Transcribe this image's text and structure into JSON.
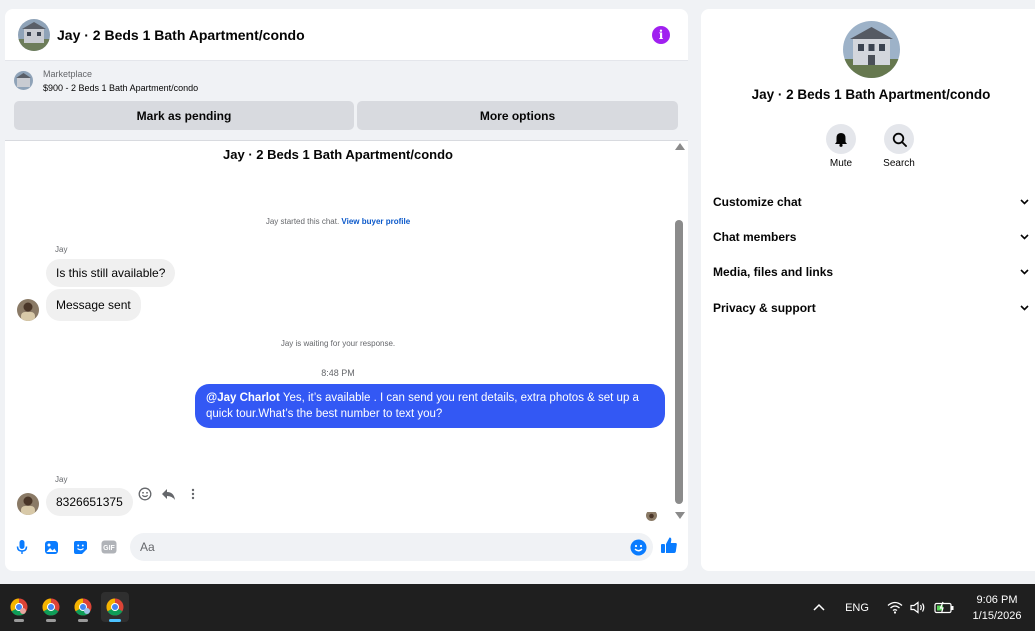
{
  "header": {
    "title": "Jay · 2 Beds 1 Bath Apartment/condo",
    "info_icon": "i"
  },
  "listing": {
    "source": "Marketplace",
    "price_title": "$900 - 2 Beds 1 Bath Apartment/condo",
    "mark_pending_label": "Mark as pending",
    "more_options_label": "More options"
  },
  "conversation": {
    "topic": "Jay · 2 Beds 1 Bath Apartment/condo",
    "started_text": "Jay started this chat.",
    "view_profile_link": "View buyer profile",
    "sender_name": "Jay",
    "msg1": "Is this still available?",
    "msg2": "Message sent",
    "waiting_text": "Jay is waiting for your response.",
    "time": "8:48 PM",
    "reply_mention": "@Jay Charlot",
    "reply_text": " Yes, it’s available .  I can send you rent details, extra photos & set up a quick tour.What’s the best number to text you?",
    "sender_name_2": "Jay",
    "msg3": "8326651375"
  },
  "composer": {
    "placeholder": "Aa",
    "gif_label": "GIF"
  },
  "info_panel": {
    "title": "Jay · 2 Beds 1 Bath Apartment/condo",
    "mute_label": "Mute",
    "search_label": "Search",
    "sections": [
      "Customize chat",
      "Chat members",
      "Media, files and links",
      "Privacy & support"
    ]
  },
  "taskbar": {
    "language": "ENG",
    "time": "9:06 PM",
    "date": "1/15/2026"
  },
  "colors": {
    "accent": "#3358f4",
    "info": "#a020f0",
    "link": "#0a58ca",
    "composer_icons": "#0a7cff"
  }
}
